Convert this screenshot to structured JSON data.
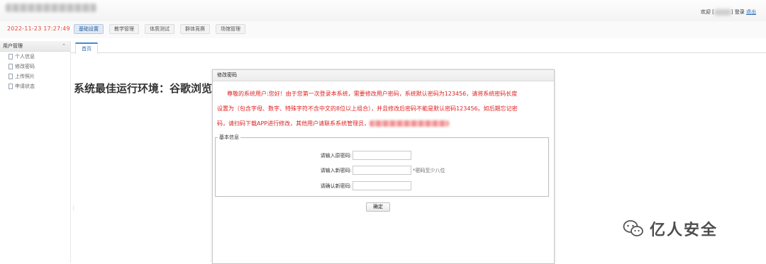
{
  "header": {
    "welcome_label": "欢迎",
    "bracket_open": "[",
    "bracket_close": "]",
    "login_label": "登录",
    "logout_label": "退出"
  },
  "navbar": {
    "datetime": "2022-11-23 17:27:49",
    "menu": [
      "基础设置",
      "教学管理",
      "体质测试",
      "群体竞赛",
      "场馆管理"
    ]
  },
  "sidebar": {
    "title": "用户管理",
    "collapse_icon": "⌃",
    "items": [
      "个人信息",
      "修改密码",
      "上传照片",
      "申请状态"
    ]
  },
  "tabs": [
    "首页"
  ],
  "main": {
    "env_text": "系统最佳运行环境：谷歌浏览器"
  },
  "dialog": {
    "title": "修改密码",
    "notice_line1": "尊敬的系统用户:您好！由于您第一次登录本系统，需要修改用户密码，系统默认密码为123456，请将系统密码长度",
    "notice_line2": "设置为（包含字母、数字、特殊字符不含中文的8位以上组合），并且修改后密码不能是默认密码123456。如后期忘记密",
    "notice_line3": "码，请扫码下载APP进行修改，其他用户请联系系统管理员，",
    "fieldset_legend": "基本信息",
    "fields": [
      {
        "label": "请输入原密码:",
        "value": "",
        "hint": ""
      },
      {
        "label": "请输入新密码:",
        "value": "",
        "hint": "*密码至少八位"
      },
      {
        "label": "请确认新密码:",
        "value": "",
        "hint": ""
      }
    ],
    "submit_label": "确定"
  },
  "watermark": {
    "text": "亿人安全",
    "icon": "wechat-icon"
  },
  "colors": {
    "datetime": "#e24a3a",
    "notice": "#e02020",
    "link": "#2a6bb5",
    "tab_accent": "#3c8dd9"
  }
}
